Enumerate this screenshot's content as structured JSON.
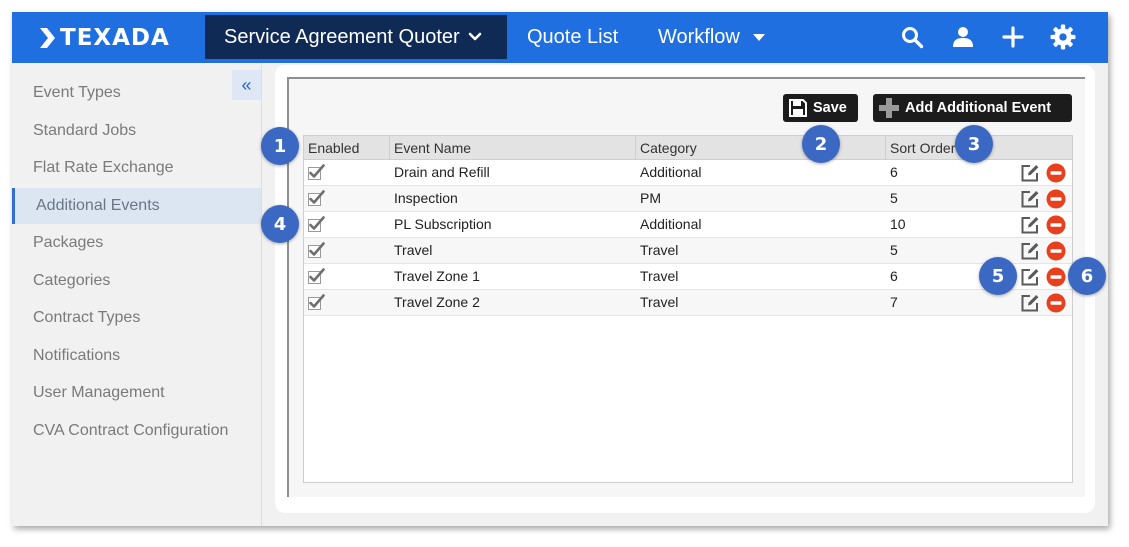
{
  "app": {
    "logo_text": "TEXADA",
    "brand_color": "#1f6fe0",
    "active_nav_color": "#0f2a55"
  },
  "topnav": {
    "active": "Service Agreement Quoter",
    "quote_list": "Quote List",
    "workflow": "Workflow",
    "icons": [
      "search-icon",
      "user-icon",
      "plus-icon",
      "gear-icon"
    ]
  },
  "sidebar": {
    "collapse_icon": "«",
    "items": [
      {
        "label": "Event Types",
        "active": false
      },
      {
        "label": "Standard Jobs",
        "active": false
      },
      {
        "label": "Flat Rate Exchange",
        "active": false
      },
      {
        "label": "Additional Events",
        "active": true
      },
      {
        "label": "Packages",
        "active": false
      },
      {
        "label": "Categories",
        "active": false
      },
      {
        "label": "Contract Types",
        "active": false
      },
      {
        "label": "Notifications",
        "active": false
      },
      {
        "label": "User Management",
        "active": false
      },
      {
        "label": "CVA Contract Configuration",
        "active": false
      }
    ]
  },
  "toolbar": {
    "save_label": "Save",
    "add_label": "Add Additional Event"
  },
  "grid": {
    "columns": [
      "Enabled",
      "Event Name",
      "Category",
      "Sort Order"
    ],
    "rows": [
      {
        "enabled": true,
        "name": "Drain and Refill",
        "category": "Additional",
        "sort": "6"
      },
      {
        "enabled": true,
        "name": "Inspection",
        "category": "PM",
        "sort": "5"
      },
      {
        "enabled": true,
        "name": "PL Subscription",
        "category": "Additional",
        "sort": "10"
      },
      {
        "enabled": true,
        "name": "Travel",
        "category": "Travel",
        "sort": "5"
      },
      {
        "enabled": true,
        "name": "Travel Zone 1",
        "category": "Travel",
        "sort": "6"
      },
      {
        "enabled": true,
        "name": "Travel Zone 2",
        "category": "Travel",
        "sort": "7"
      }
    ],
    "row_icons": [
      "edit-icon",
      "remove-icon"
    ],
    "remove_color": "#e8401c"
  },
  "callouts": [
    "1",
    "2",
    "3",
    "4",
    "5",
    "6"
  ]
}
